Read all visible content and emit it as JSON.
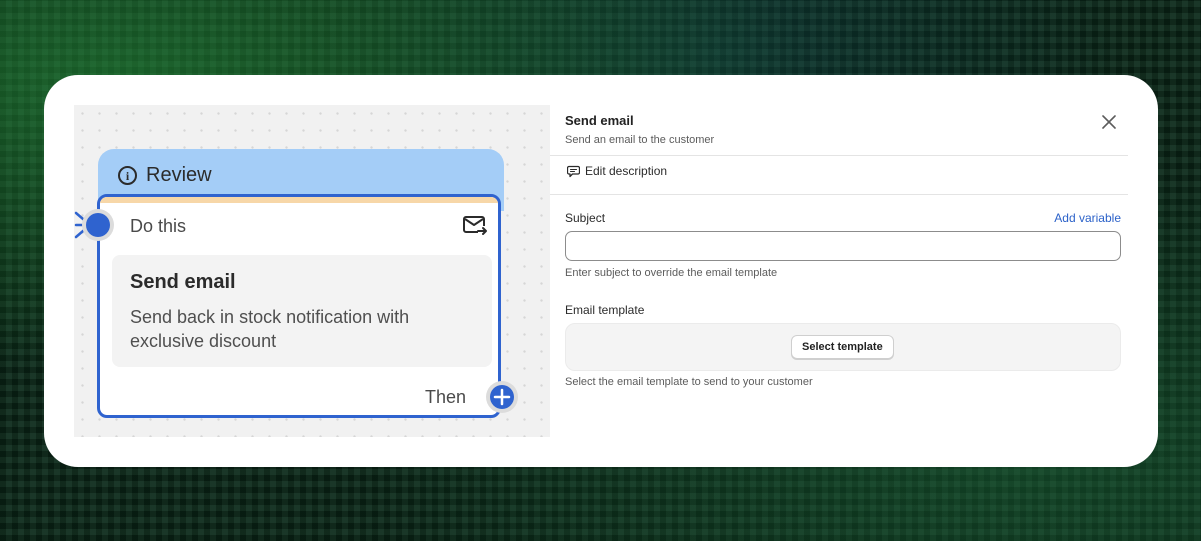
{
  "node": {
    "title": "Review",
    "step_label": "Do this",
    "action_title": "Send email",
    "action_description": "Send back in stock notification with exclusive discount",
    "then_label": "Then"
  },
  "panel": {
    "title": "Send email",
    "subtitle": "Send an email to the customer",
    "edit_description": "Edit description",
    "subject_label": "Subject",
    "add_variable": "Add variable",
    "subject_value": "",
    "subject_help": "Enter subject to override the email template",
    "template_label": "Email template",
    "select_template": "Select template",
    "template_help": "Select the email template to send to your customer"
  },
  "colors": {
    "accent_blue": "#2f63cf",
    "header_blue": "#a4cdf7",
    "header_stripe": "#f7d7a8",
    "link_blue": "#2c62c9"
  },
  "icons": [
    "info-icon",
    "mail-send-icon",
    "plus-icon",
    "close-icon",
    "comment-icon"
  ]
}
